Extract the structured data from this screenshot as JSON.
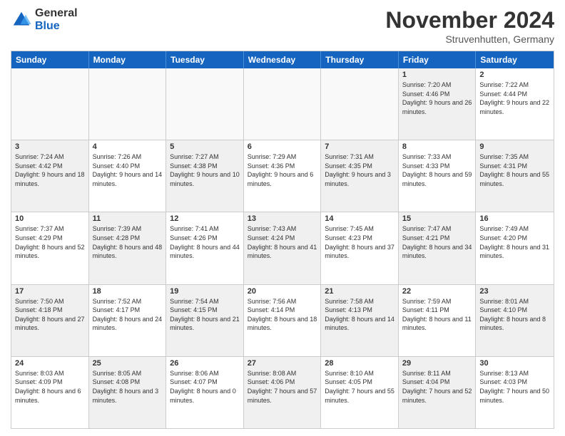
{
  "header": {
    "logo_general": "General",
    "logo_blue": "Blue",
    "month_title": "November 2024",
    "location": "Struvenhutten, Germany"
  },
  "calendar": {
    "days_of_week": [
      "Sunday",
      "Monday",
      "Tuesday",
      "Wednesday",
      "Thursday",
      "Friday",
      "Saturday"
    ],
    "weeks": [
      [
        {
          "day": "",
          "text": "",
          "empty": true
        },
        {
          "day": "",
          "text": "",
          "empty": true
        },
        {
          "day": "",
          "text": "",
          "empty": true
        },
        {
          "day": "",
          "text": "",
          "empty": true
        },
        {
          "day": "",
          "text": "",
          "empty": true
        },
        {
          "day": "1",
          "text": "Sunrise: 7:20 AM\nSunset: 4:46 PM\nDaylight: 9 hours and 26 minutes.",
          "shaded": true
        },
        {
          "day": "2",
          "text": "Sunrise: 7:22 AM\nSunset: 4:44 PM\nDaylight: 9 hours and 22 minutes.",
          "shaded": false
        }
      ],
      [
        {
          "day": "3",
          "text": "Sunrise: 7:24 AM\nSunset: 4:42 PM\nDaylight: 9 hours and 18 minutes.",
          "shaded": true
        },
        {
          "day": "4",
          "text": "Sunrise: 7:26 AM\nSunset: 4:40 PM\nDaylight: 9 hours and 14 minutes.",
          "shaded": false
        },
        {
          "day": "5",
          "text": "Sunrise: 7:27 AM\nSunset: 4:38 PM\nDaylight: 9 hours and 10 minutes.",
          "shaded": true
        },
        {
          "day": "6",
          "text": "Sunrise: 7:29 AM\nSunset: 4:36 PM\nDaylight: 9 hours and 6 minutes.",
          "shaded": false
        },
        {
          "day": "7",
          "text": "Sunrise: 7:31 AM\nSunset: 4:35 PM\nDaylight: 9 hours and 3 minutes.",
          "shaded": true
        },
        {
          "day": "8",
          "text": "Sunrise: 7:33 AM\nSunset: 4:33 PM\nDaylight: 8 hours and 59 minutes.",
          "shaded": false
        },
        {
          "day": "9",
          "text": "Sunrise: 7:35 AM\nSunset: 4:31 PM\nDaylight: 8 hours and 55 minutes.",
          "shaded": true
        }
      ],
      [
        {
          "day": "10",
          "text": "Sunrise: 7:37 AM\nSunset: 4:29 PM\nDaylight: 8 hours and 52 minutes.",
          "shaded": false
        },
        {
          "day": "11",
          "text": "Sunrise: 7:39 AM\nSunset: 4:28 PM\nDaylight: 8 hours and 48 minutes.",
          "shaded": true
        },
        {
          "day": "12",
          "text": "Sunrise: 7:41 AM\nSunset: 4:26 PM\nDaylight: 8 hours and 44 minutes.",
          "shaded": false
        },
        {
          "day": "13",
          "text": "Sunrise: 7:43 AM\nSunset: 4:24 PM\nDaylight: 8 hours and 41 minutes.",
          "shaded": true
        },
        {
          "day": "14",
          "text": "Sunrise: 7:45 AM\nSunset: 4:23 PM\nDaylight: 8 hours and 37 minutes.",
          "shaded": false
        },
        {
          "day": "15",
          "text": "Sunrise: 7:47 AM\nSunset: 4:21 PM\nDaylight: 8 hours and 34 minutes.",
          "shaded": true
        },
        {
          "day": "16",
          "text": "Sunrise: 7:49 AM\nSunset: 4:20 PM\nDaylight: 8 hours and 31 minutes.",
          "shaded": false
        }
      ],
      [
        {
          "day": "17",
          "text": "Sunrise: 7:50 AM\nSunset: 4:18 PM\nDaylight: 8 hours and 27 minutes.",
          "shaded": true
        },
        {
          "day": "18",
          "text": "Sunrise: 7:52 AM\nSunset: 4:17 PM\nDaylight: 8 hours and 24 minutes.",
          "shaded": false
        },
        {
          "day": "19",
          "text": "Sunrise: 7:54 AM\nSunset: 4:15 PM\nDaylight: 8 hours and 21 minutes.",
          "shaded": true
        },
        {
          "day": "20",
          "text": "Sunrise: 7:56 AM\nSunset: 4:14 PM\nDaylight: 8 hours and 18 minutes.",
          "shaded": false
        },
        {
          "day": "21",
          "text": "Sunrise: 7:58 AM\nSunset: 4:13 PM\nDaylight: 8 hours and 14 minutes.",
          "shaded": true
        },
        {
          "day": "22",
          "text": "Sunrise: 7:59 AM\nSunset: 4:11 PM\nDaylight: 8 hours and 11 minutes.",
          "shaded": false
        },
        {
          "day": "23",
          "text": "Sunrise: 8:01 AM\nSunset: 4:10 PM\nDaylight: 8 hours and 8 minutes.",
          "shaded": true
        }
      ],
      [
        {
          "day": "24",
          "text": "Sunrise: 8:03 AM\nSunset: 4:09 PM\nDaylight: 8 hours and 6 minutes.",
          "shaded": false
        },
        {
          "day": "25",
          "text": "Sunrise: 8:05 AM\nSunset: 4:08 PM\nDaylight: 8 hours and 3 minutes.",
          "shaded": true
        },
        {
          "day": "26",
          "text": "Sunrise: 8:06 AM\nSunset: 4:07 PM\nDaylight: 8 hours and 0 minutes.",
          "shaded": false
        },
        {
          "day": "27",
          "text": "Sunrise: 8:08 AM\nSunset: 4:06 PM\nDaylight: 7 hours and 57 minutes.",
          "shaded": true
        },
        {
          "day": "28",
          "text": "Sunrise: 8:10 AM\nSunset: 4:05 PM\nDaylight: 7 hours and 55 minutes.",
          "shaded": false
        },
        {
          "day": "29",
          "text": "Sunrise: 8:11 AM\nSunset: 4:04 PM\nDaylight: 7 hours and 52 minutes.",
          "shaded": true
        },
        {
          "day": "30",
          "text": "Sunrise: 8:13 AM\nSunset: 4:03 PM\nDaylight: 7 hours and 50 minutes.",
          "shaded": false
        }
      ]
    ]
  }
}
